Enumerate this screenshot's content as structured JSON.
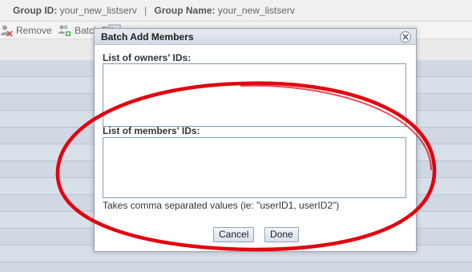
{
  "group_header": {
    "group_id_label": "Group ID:",
    "group_id_value": "your_new_listserv",
    "separator": "|",
    "group_name_label": "Group Name:",
    "group_name_value": "your_new_listserv"
  },
  "toolbar": {
    "remove_label": "Remove",
    "batch_label": "Batch Edit"
  },
  "modal": {
    "title": "Batch Add Members",
    "owners_label": "List of owners' IDs:",
    "owners_value": "",
    "members_label": "List of members' IDs:",
    "members_value": "",
    "hint": "Takes comma separated values (ie: \"userID1, userID2\")",
    "cancel_label": "Cancel",
    "done_label": "Done"
  },
  "colors": {
    "annotation": "#e3000f",
    "grid_row": "#cfd8e3",
    "textarea_border": "#7b9dbb"
  },
  "icons": [
    "remove-user-icon",
    "batch-add-icon",
    "sort-icon",
    "close-icon"
  ]
}
